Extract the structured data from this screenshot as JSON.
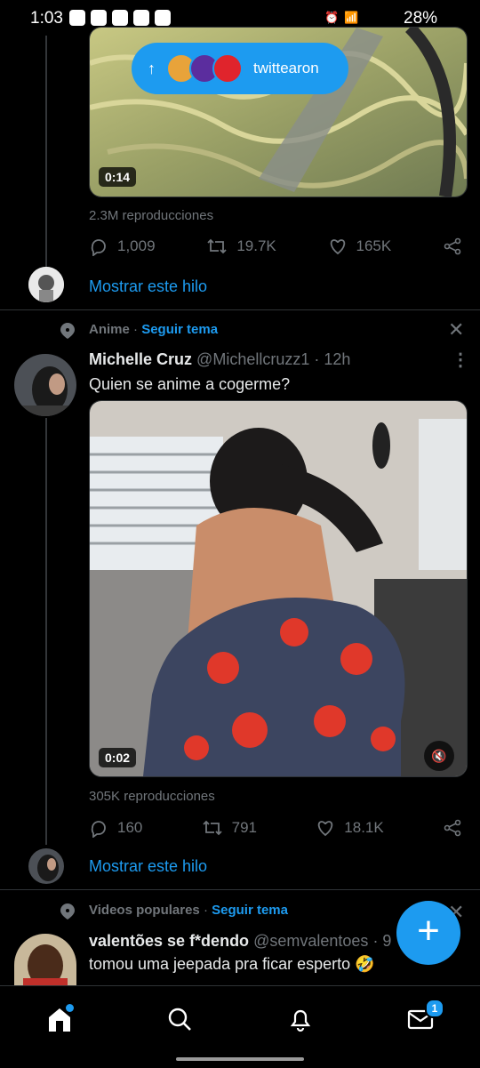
{
  "status": {
    "time": "1:03",
    "battery": "28%"
  },
  "toast": {
    "label": "twittearon"
  },
  "tweet1": {
    "duration": "0:14",
    "views": "2.3M reproducciones",
    "replies": "1,009",
    "retweets": "19.7K",
    "likes": "165K",
    "show_thread": "Mostrar este hilo"
  },
  "tweet2": {
    "topic": "Anime",
    "follow_topic": "Seguir tema",
    "name": "Michelle Cruz",
    "handle": "@Michellcruzz1",
    "time": "· 12h",
    "text": "Quien se anime a cogerme?",
    "duration": "0:02",
    "views": "305K reproducciones",
    "replies": "160",
    "retweets": "791",
    "likes": "18.1K",
    "show_thread": "Mostrar este hilo"
  },
  "tweet3": {
    "topic": "Videos populares",
    "follow_topic": "Seguir tema",
    "name": "valentões se f*dendo",
    "handle": "@semvalentoes",
    "time": "· 9h",
    "text": "tomou uma jeepada pra ficar esperto 🤣"
  },
  "nav": {
    "messages_badge": "1"
  },
  "colors": {
    "accent": "#1d9bf0",
    "background": "#000000",
    "divider": "#2f3336"
  }
}
